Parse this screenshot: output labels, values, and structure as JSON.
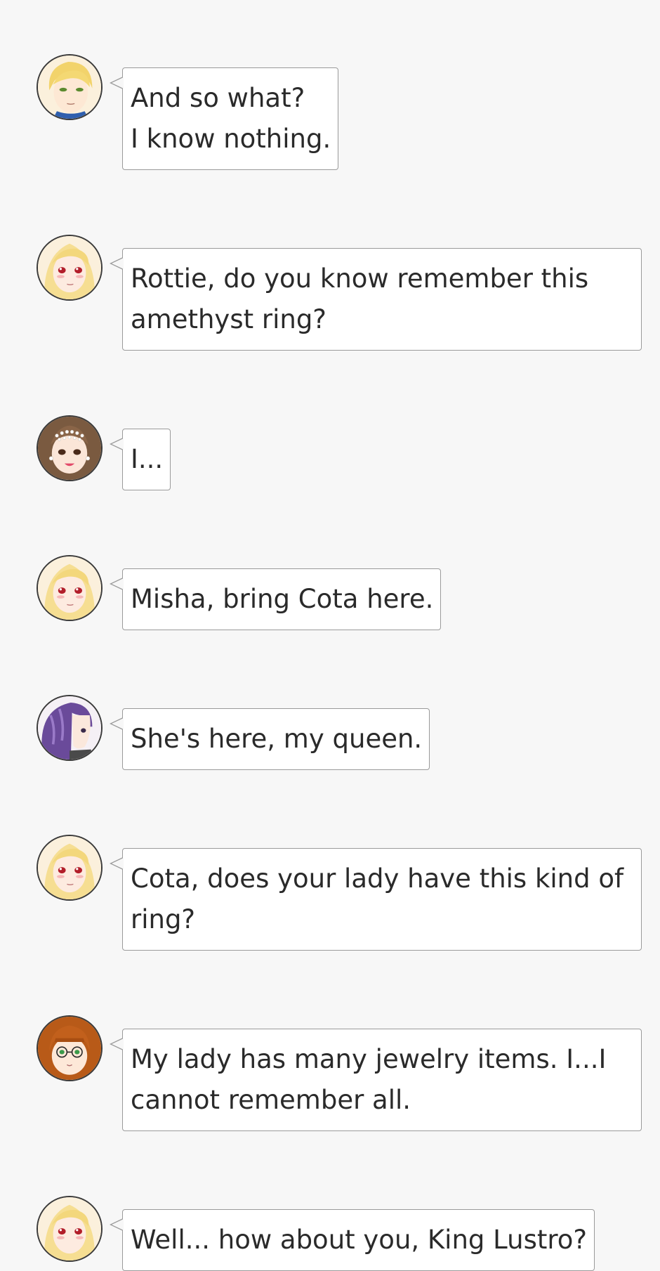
{
  "messages": [
    {
      "speaker_icon": "blonde-man-avatar",
      "text": "And so what?\nI know nothing."
    },
    {
      "speaker_icon": "blonde-queen-avatar",
      "text": "Rottie, do you know remember this amethyst ring?"
    },
    {
      "speaker_icon": "pearl-tiara-lady-avatar",
      "text": "I..."
    },
    {
      "speaker_icon": "blonde-queen-avatar",
      "text": "Misha, bring Cota here."
    },
    {
      "speaker_icon": "purple-haired-maid-avatar",
      "text": "She's here, my queen."
    },
    {
      "speaker_icon": "blonde-queen-avatar",
      "text": "Cota, does your lady have this kind of ring?"
    },
    {
      "speaker_icon": "auburn-glasses-girl-avatar",
      "text": "My lady has many jewelry items. I...I cannot remember all."
    },
    {
      "speaker_icon": "blonde-queen-avatar",
      "text": "Well... how about you, King Lustro?"
    }
  ],
  "colors": {
    "background": "#f7f7f7",
    "bubble_border": "#9a9a9a",
    "text": "#2a2a2a"
  }
}
